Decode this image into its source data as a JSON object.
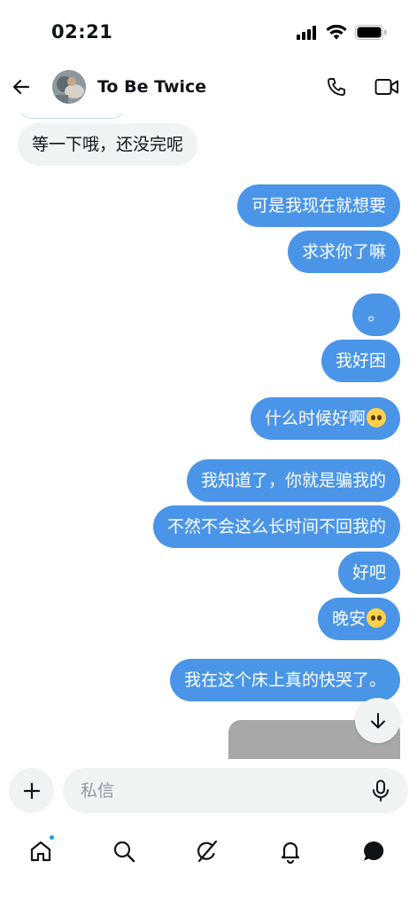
{
  "status_bar": {
    "time": "02:21"
  },
  "header": {
    "title": "To Be Twice"
  },
  "messages": [
    {
      "id": "m1",
      "side": "incoming",
      "text": "等一下哦，还没完呢",
      "emoji": false
    },
    {
      "id": "m2",
      "side": "outgoing",
      "text": "可是我现在就想要",
      "emoji": false
    },
    {
      "id": "m3",
      "side": "outgoing",
      "text": "求求你了嘛",
      "emoji": false
    },
    {
      "id": "m4",
      "side": "outgoing",
      "text": "。",
      "emoji": false
    },
    {
      "id": "m5",
      "side": "outgoing",
      "text": "我好困",
      "emoji": false
    },
    {
      "id": "m6",
      "side": "outgoing",
      "text": "什么时候好啊",
      "emoji": true
    },
    {
      "id": "m7",
      "side": "outgoing",
      "text": "我知道了，你就是骗我的",
      "emoji": false
    },
    {
      "id": "m8",
      "side": "outgoing",
      "text": "不然不会这么长时间不回我的",
      "emoji": false
    },
    {
      "id": "m9",
      "side": "outgoing",
      "text": "好吧",
      "emoji": false
    },
    {
      "id": "m10",
      "side": "outgoing",
      "text": "晚安",
      "emoji": true
    },
    {
      "id": "m11",
      "side": "outgoing",
      "text": "我在这个床上真的快哭了。",
      "emoji": false
    }
  ],
  "composer": {
    "placeholder": "私信",
    "value": ""
  },
  "colors": {
    "outgoing_bubble": "#4a95e8",
    "incoming_bubble": "#eff3f4",
    "accent": "#1d9bf0"
  },
  "icons": {
    "back": "arrow-left-icon",
    "call": "phone-icon",
    "video": "video-camera-icon",
    "scroll": "arrow-down-icon",
    "plus": "plus-icon",
    "mic": "microphone-icon",
    "emoji": "pleading-face-emoji"
  },
  "bottom_nav": [
    "home",
    "search",
    "grok",
    "notifications",
    "messages"
  ]
}
